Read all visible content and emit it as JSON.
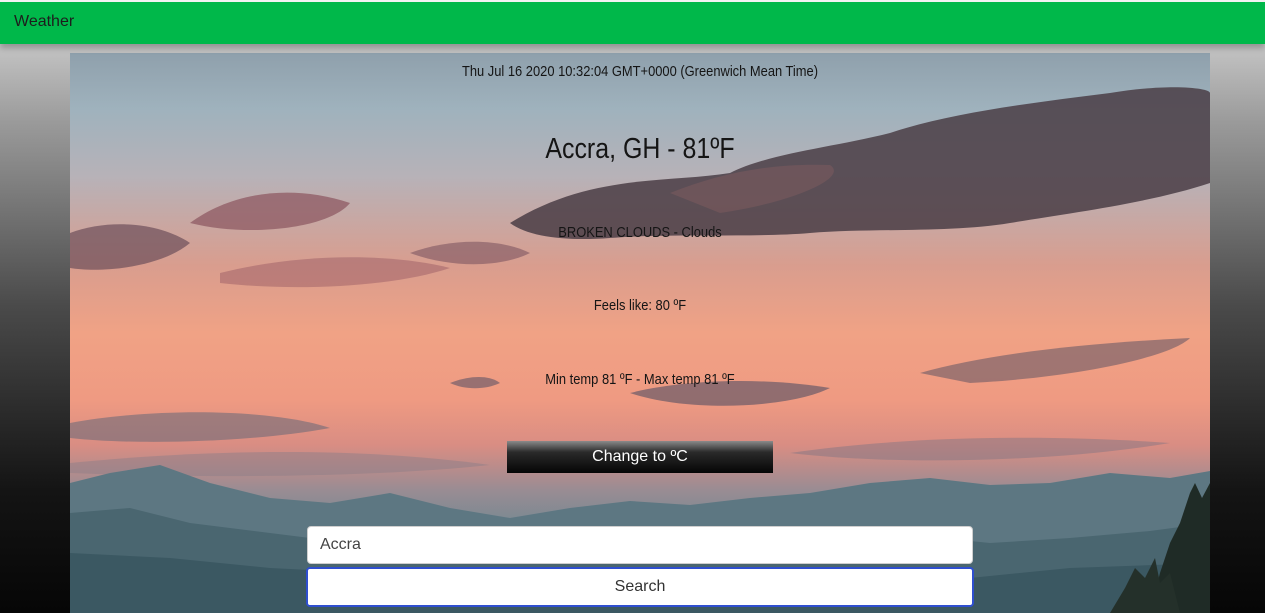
{
  "navbar": {
    "title": "Weather"
  },
  "weather": {
    "datetime": "Thu Jul 16 2020 10:32:04 GMT+0000 (Greenwich Mean Time)",
    "city_temp": "Accra, GH - 81ºF",
    "description": "BROKEN CLOUDS - Clouds",
    "feels_like": "Feels like: 80 ºF",
    "min_max": "Min temp 81 ºF - Max temp 81 ºF",
    "unit_button_label": "Change to ºC"
  },
  "search": {
    "value": "Accra",
    "placeholder": "Accra",
    "button_label": "Search"
  },
  "colors": {
    "navbar": "#00b84a",
    "search_button_border": "#2f4fd0"
  }
}
